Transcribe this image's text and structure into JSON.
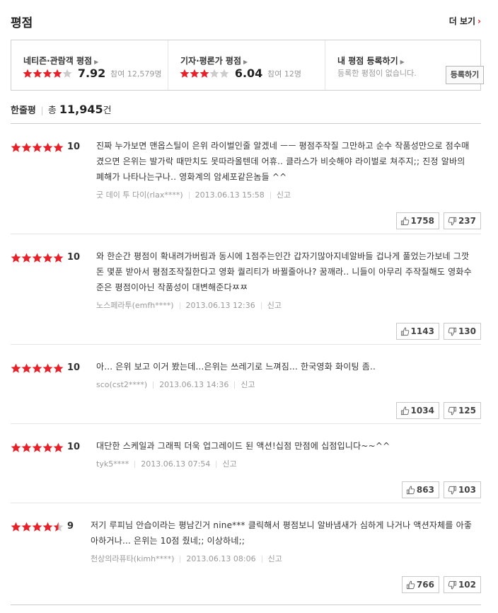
{
  "section_title": "평점",
  "more_label": "더 보기",
  "summary": {
    "audience": {
      "label": "네티즌·관람객 평점",
      "score": "7.92",
      "participants": "참여 12,579명",
      "rating_of_5": 4
    },
    "critic": {
      "label": "기자·평론가 평점",
      "score": "6.04",
      "participants": "참여 12명",
      "rating_of_5": 3
    },
    "mine": {
      "label": "내 평점 등록하기",
      "note": "등록한 평점이 없습니다.",
      "button": "등록하기"
    }
  },
  "one_line": {
    "label": "한줄평",
    "total_prefix": "총",
    "count": "11,945",
    "unit": "건"
  },
  "reviews": [
    {
      "stars_of_5": 5,
      "score": "10",
      "text": "진짜 누가보면 맨옵스틸이 은위 라이벌인줄 알겠네 ㅡㅡ 평점주작질 그만하고 순수 작품성만으로 점수매겼으면 은위는 발가락 때만치도 못따라올텐데 어휴.. 클라스가 비슷해야 라이벌로 쳐주지;; 진정 알바의 폐해가 나타나는구나.. 영화계의 암세포같은놈들 ^^",
      "author": "굿 데이 투 다이(rlax****)",
      "date": "2013.06.13 15:58",
      "report": "신고",
      "likes": "1758",
      "dislikes": "237"
    },
    {
      "stars_of_5": 5,
      "score": "10",
      "text": "와 한순간 평점이 확내려가버림과 동시에 1점주는인간 갑자기많아지네알바들 겁나게 풀었는가보네 그깟 돈 몇푼 받아서 평점조작질한다고 영화 퀄리티가 바뀔줄아나? 꿈깨라.. 니들이 아무리 주작질해도 영화수준은 평점이아닌 작품성이 대변해준다ㅉㅉ",
      "author": "노스페라투(emfh****)",
      "date": "2013.06.13 12:36",
      "report": "신고",
      "likes": "1143",
      "dislikes": "130"
    },
    {
      "stars_of_5": 5,
      "score": "10",
      "text": "아... 은위 보고 이거 봤는데...은위는 쓰레기로 느껴짐... 한국영화 화이팅 좀..",
      "author": "sco(cst2****)",
      "date": "2013.06.13 14:36",
      "report": "신고",
      "likes": "1034",
      "dislikes": "125"
    },
    {
      "stars_of_5": 5,
      "score": "10",
      "text": "대단한 스케일과 그래픽 더욱 업그레이드 된 액션!십점 만점에 십점입니다~~^^",
      "author": "tyk5****",
      "date": "2013.06.13 07:54",
      "report": "신고",
      "likes": "863",
      "dislikes": "103"
    },
    {
      "stars_of_5": 4.5,
      "score": "9",
      "text": "저기 루피님 안습이라는 평남긴거 nine*** 클릭해서 평점보니 알바냄새가 심하게 나거나 액션자체를 아좋아하거나... 은위는 10점 줬네;; 이상하네;;",
      "author": "천상의라퓨타(kimh****)",
      "date": "2013.06.13 08:06",
      "report": "신고",
      "likes": "766",
      "dislikes": "102"
    }
  ],
  "colors": {
    "star_on": "#e6212a",
    "star_off": "#cccccc",
    "accent": "#e6212a"
  },
  "icons": {
    "more": "chevron-right-icon",
    "like": "thumbs-up-icon",
    "dislike": "thumbs-down-icon",
    "star": "star-icon"
  }
}
